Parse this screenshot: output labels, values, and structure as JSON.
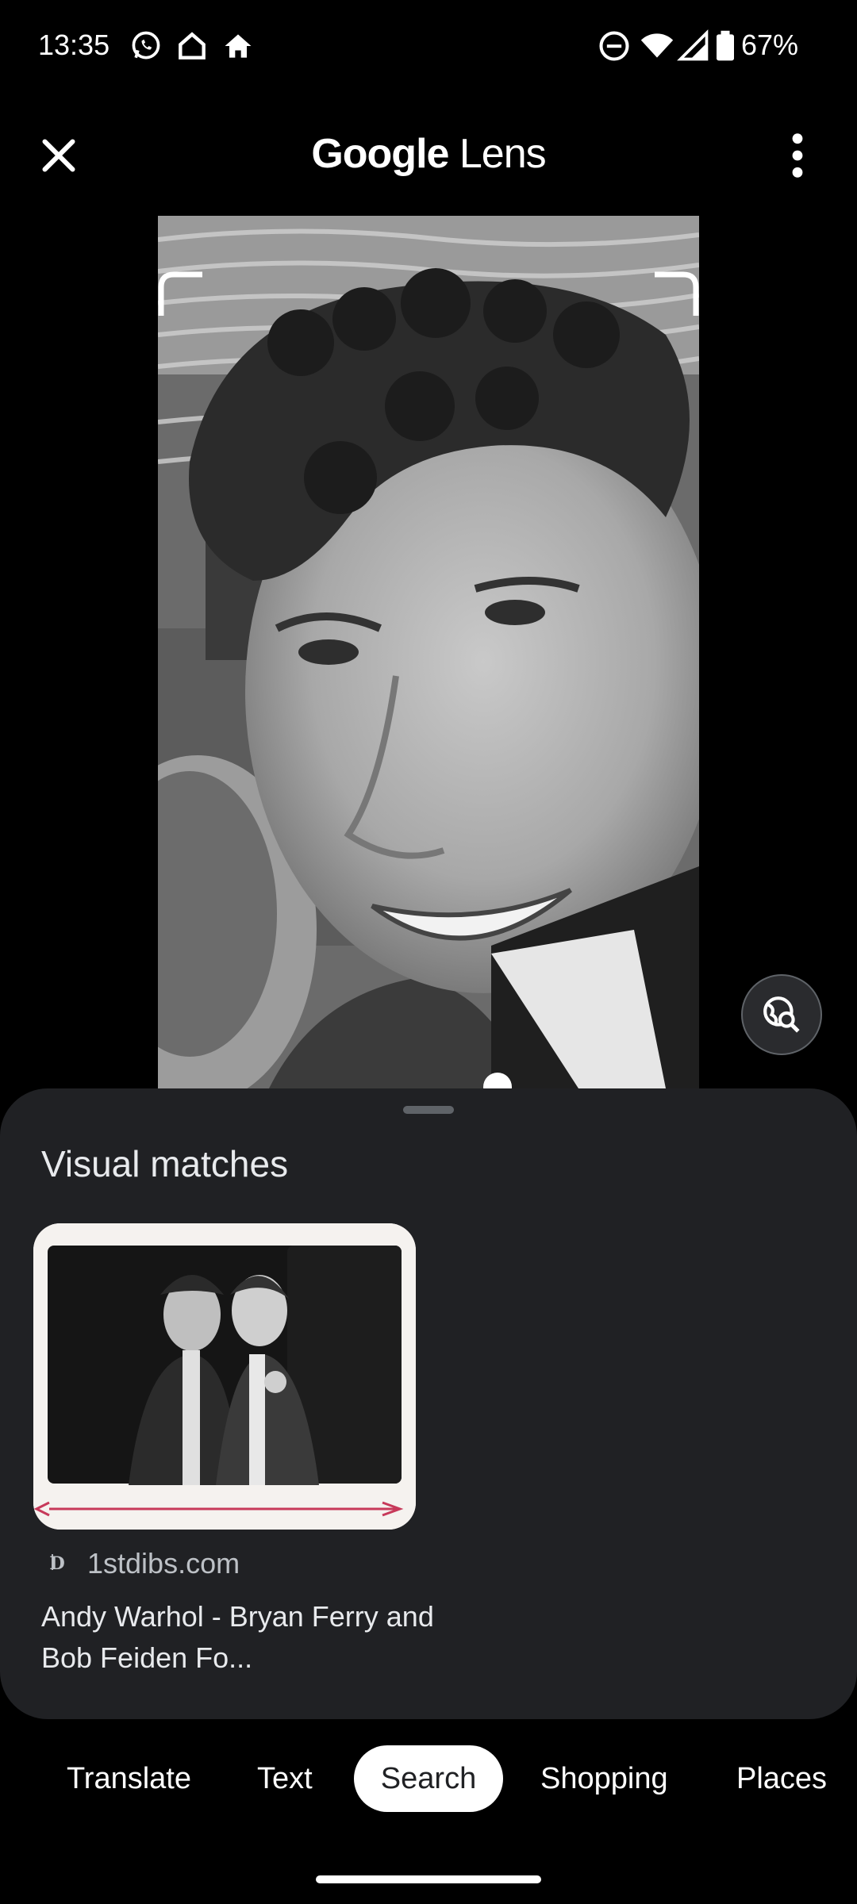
{
  "status_bar": {
    "time": "13:35",
    "battery": "67%",
    "icons": [
      "whatsapp-icon",
      "home-outline-icon",
      "home-icon",
      "dnd-icon",
      "wifi-icon",
      "signal-icon",
      "battery-icon"
    ]
  },
  "header": {
    "title_brand": "Google",
    "title_product": " Lens",
    "close_icon": "close-icon",
    "menu_icon": "more-vert-icon"
  },
  "main": {
    "lens_button_icon": "visual-search-icon"
  },
  "sheet": {
    "section_title": "Visual matches",
    "result": {
      "source": "1stdibs.com",
      "title": "Andy Warhol - Bryan Ferry and Bob Feiden Fo..."
    }
  },
  "tabs": [
    "Translate",
    "Text",
    "Search",
    "Shopping",
    "Places"
  ],
  "active_tab": "Search",
  "colors": {
    "background": "#000000",
    "sheet": "#202124",
    "active_tab_bg": "#ffffff",
    "text_secondary": "#bdc1c6"
  }
}
